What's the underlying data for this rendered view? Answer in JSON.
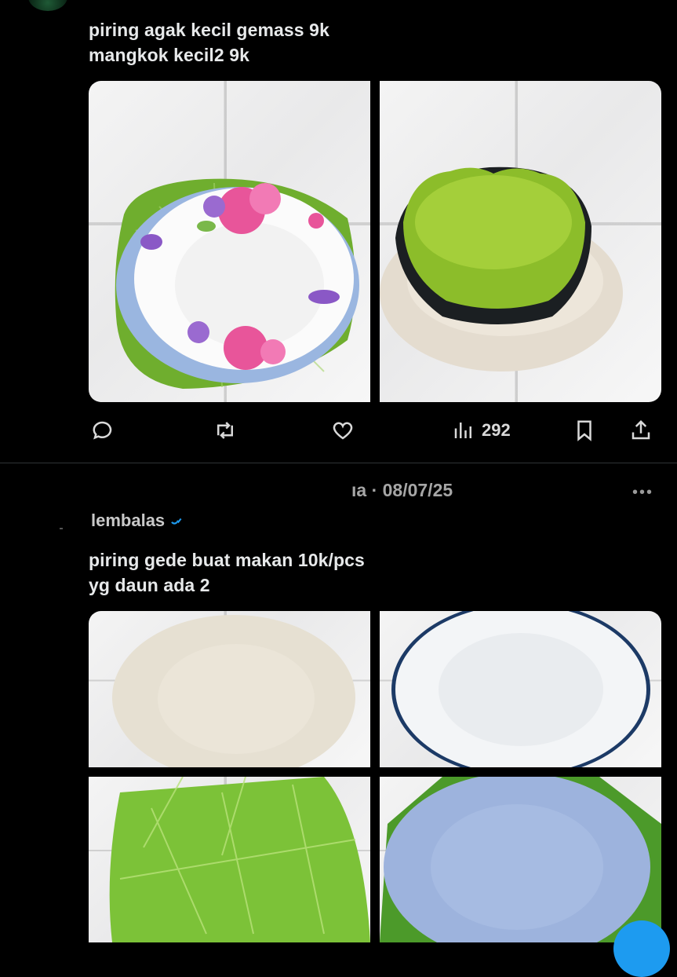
{
  "tweet1": {
    "line1": "piring agak kecil gemass 9k",
    "line2": "mangkok kecil2 9k",
    "actions": {
      "views_count": "292"
    }
  },
  "tweet2": {
    "header_partial": "ıa · 08/07/25",
    "more": "•••",
    "reply_label": "lembalas",
    "line1": "piring gede buat makan 10k/pcs",
    "line2": "yg daun ada 2"
  },
  "colors": {
    "accent": "#1d9bf0",
    "background": "#000000",
    "text": "#e7e9ea"
  },
  "icons": [
    "reply-icon",
    "retweet-icon",
    "like-icon",
    "views-icon",
    "bookmark-icon",
    "share-icon",
    "more-icon",
    "verified-icon"
  ]
}
